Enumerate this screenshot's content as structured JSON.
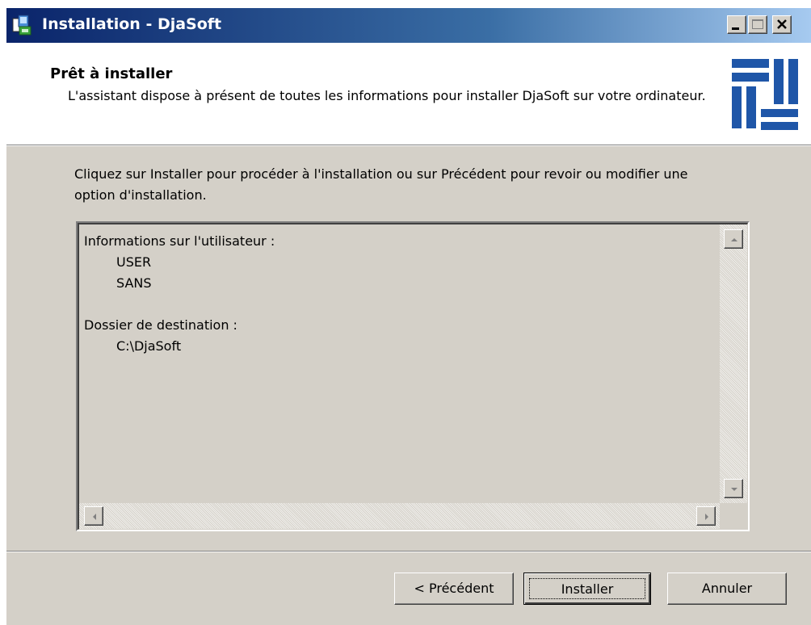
{
  "window": {
    "title": "Installation - DjaSoft"
  },
  "header": {
    "title": "Prêt à installer",
    "description": "L'assistant dispose à présent de toutes les informations pour installer DjaSoft sur votre ordinateur."
  },
  "body": {
    "instruction": "Cliquez sur Installer pour procéder à l'installation ou sur Précédent pour revoir ou modifier une option d'installation.",
    "summary": {
      "user_section_label": "Informations sur l'utilisateur :",
      "user_name": "USER",
      "user_org": "SANS",
      "dest_section_label": "Dossier de destination :",
      "dest_path": "C:\\DjaSoft"
    }
  },
  "buttons": {
    "back_label": "< Précédent",
    "install_label": "Installer",
    "cancel_label": "Annuler"
  },
  "colors": {
    "titlebar_start": "#0a246a",
    "titlebar_end": "#a6caf0",
    "dialog_bg": "#d4d0c8",
    "logo_blue": "#1f56a8"
  }
}
